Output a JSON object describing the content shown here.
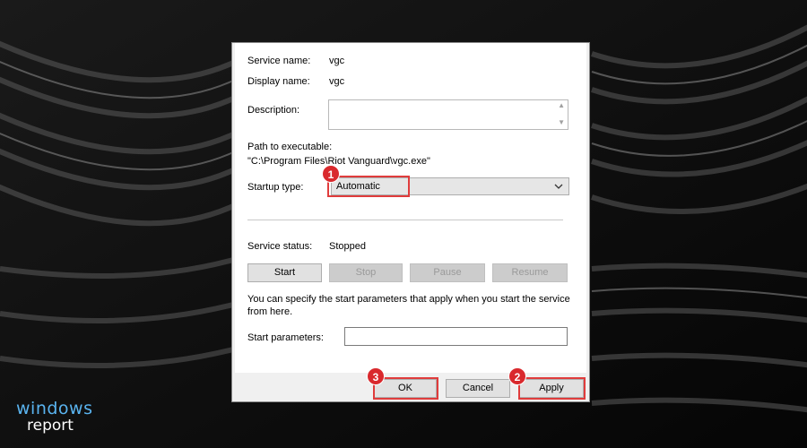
{
  "general": {
    "service_name_label": "Service name:",
    "service_name_value": "vgc",
    "display_name_label": "Display name:",
    "display_name_value": "vgc",
    "description_label": "Description:",
    "description_value": "",
    "path_label": "Path to executable:",
    "path_value": "\"C:\\Program Files\\Riot Vanguard\\vgc.exe\"",
    "startup_type_label": "Startup type:",
    "startup_type_value": "Automatic",
    "service_status_label": "Service status:",
    "service_status_value": "Stopped",
    "start_label": "Start",
    "stop_label": "Stop",
    "pause_label": "Pause",
    "resume_label": "Resume",
    "hint_text_line1": "You can specify the start parameters that apply when you start the service",
    "hint_text_line2": "from here.",
    "start_params_label": "Start parameters:",
    "start_params_value": ""
  },
  "footer": {
    "ok_label": "OK",
    "cancel_label": "Cancel",
    "apply_label": "Apply"
  },
  "annotations": {
    "badge_1": "1",
    "badge_2": "2",
    "badge_3": "3",
    "color": "#e03c3c"
  },
  "watermark": {
    "line1": "windows",
    "line2": "report"
  }
}
